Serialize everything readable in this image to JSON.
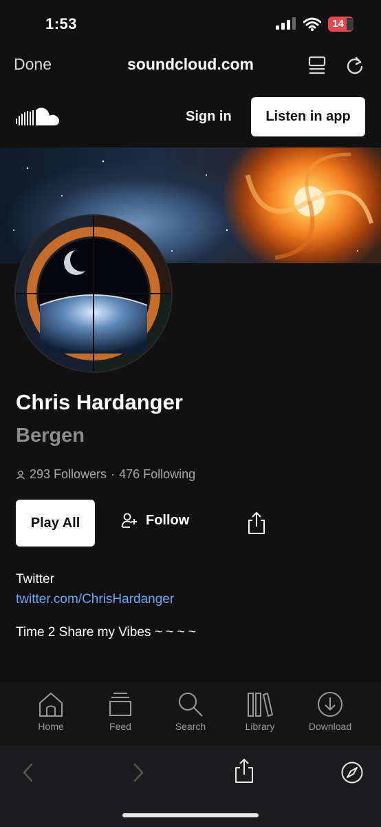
{
  "status_bar": {
    "time": "1:53",
    "battery": "14"
  },
  "browser": {
    "done_label": "Done",
    "url": "soundcloud.com"
  },
  "header": {
    "sign_in": "Sign in",
    "listen_in_app": "Listen in app"
  },
  "profile": {
    "name": "Chris Hardanger",
    "city": "Bergen",
    "followers": "293 Followers",
    "separator": "·",
    "following": "476 Following",
    "play_all": "Play All",
    "follow": "Follow",
    "twitter_label": "Twitter",
    "twitter_link": "twitter.com/ChrisHardanger",
    "bio": "Time 2 Share my Vibes ~ ~ ~ ~"
  },
  "tabs": [
    {
      "label": "Home",
      "icon": "home-icon"
    },
    {
      "label": "Feed",
      "icon": "feed-icon"
    },
    {
      "label": "Search",
      "icon": "search-icon"
    },
    {
      "label": "Library",
      "icon": "library-icon"
    },
    {
      "label": "Download",
      "icon": "download-icon"
    }
  ],
  "colors": {
    "background": "#111111",
    "link": "#6aa6f8",
    "battery": "#e5484d"
  }
}
